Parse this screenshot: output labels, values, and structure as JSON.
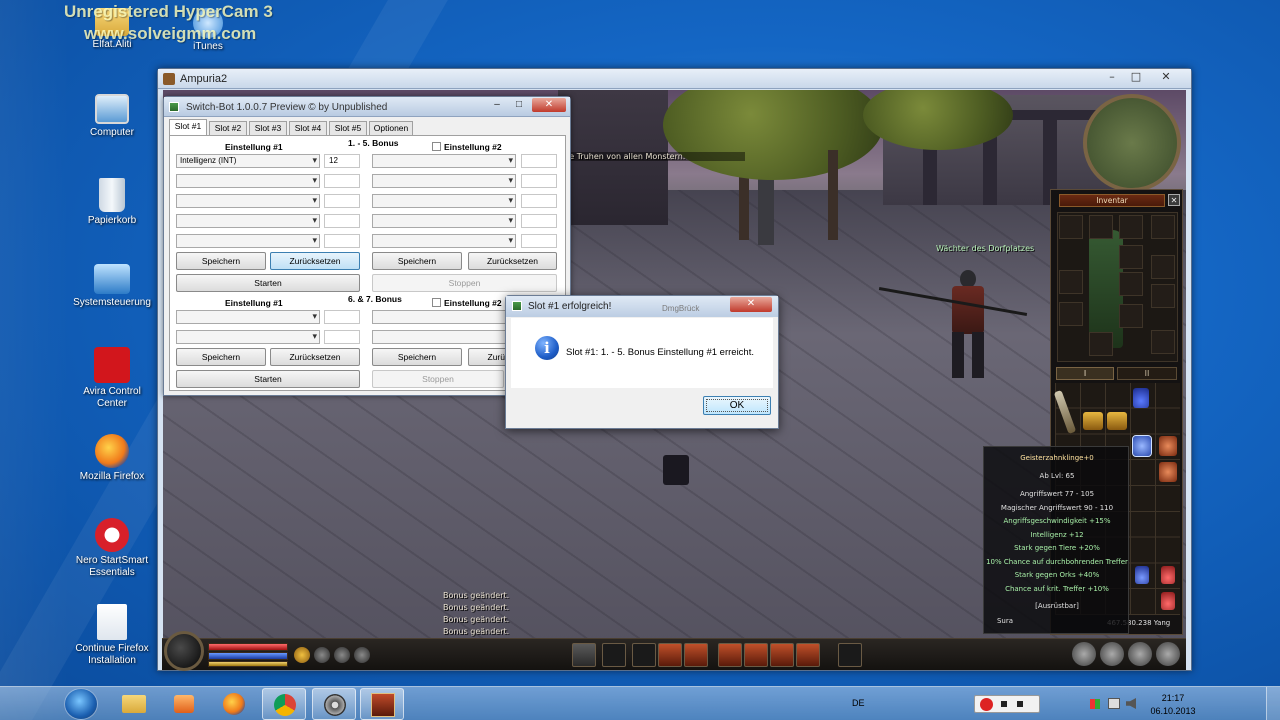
{
  "watermark": {
    "line1": "Unregistered HyperCam 3",
    "line2": "www.solveigmm.com"
  },
  "desktop_icons": [
    {
      "label": "Elfat.Aliti",
      "icon": "folder-icon"
    },
    {
      "label": "iTunes",
      "icon": "itunes-icon"
    },
    {
      "label": "Computer",
      "icon": "computer-icon"
    },
    {
      "label": "Papierkorb",
      "icon": "recycle-bin-icon"
    },
    {
      "label": "Systemsteuerung",
      "icon": "control-panel-icon"
    },
    {
      "label": "Avira Control Center",
      "icon": "avira-icon"
    },
    {
      "label": "Mozilla Firefox",
      "icon": "firefox-icon"
    },
    {
      "label": "Nero StartSmart Essentials",
      "icon": "nero-icon"
    },
    {
      "label": "Continue Firefox Installation",
      "icon": "installer-icon"
    }
  ],
  "game_window": {
    "title": "Ampuria2",
    "buttons": {
      "minimize": "–",
      "maximize": "□",
      "close": "✕"
    }
  },
  "game_hud": {
    "chat_top": "le Truhen von allen Monstern.",
    "npc_name": "Wächter des Dorfplatzes",
    "chat_lines": [
      "Bonus geändert.",
      "Bonus geändert.",
      "Bonus geändert.",
      "Bonus geändert."
    ]
  },
  "switchbot": {
    "title": "Switch-Bot 1.0.0.7 Preview © by Unpublished",
    "buttons": {
      "minimize": "–",
      "maximize": "□",
      "close": "✕"
    },
    "tabs": [
      "Slot #1",
      "Slot #2",
      "Slot #3",
      "Slot #4",
      "Slot #5",
      "Optionen"
    ],
    "section1_title": "1. - 5. Bonus",
    "section2_title": "6. & 7. Bonus",
    "einstellung1": "Einstellung #1",
    "einstellung2": "Einstellung #2",
    "bonus_row1_select": "Intelligenz (INT)",
    "bonus_row1_value": "12",
    "speichern": "Speichern",
    "zuruecksetzen": "Zurücksetzen",
    "starten": "Starten",
    "stoppen": "Stoppen",
    "zuruecksetzen_short": "Zurü"
  },
  "message_box": {
    "title": "Slot #1 erfolgreich!",
    "message": "Slot #1: 1. - 5. Bonus Einstellung #1 erreicht.",
    "ok": "OK",
    "close": "✕",
    "behind_label": "DmgBrück"
  },
  "inventory": {
    "title": "Inventar",
    "close": "✕",
    "page_tabs": [
      "I",
      "II"
    ],
    "yang": "467.580.238 Yang"
  },
  "tooltip": {
    "lines": [
      "Geisterzahnklinge+0",
      "Ab Lvl: 65",
      "Angriffswert 77 - 105",
      "Magischer Angriffswert 90 - 110",
      "Angriffsgeschwindigkeit +15%",
      "Intelligenz +12",
      "Stark gegen Tiere +20%",
      "10% Chance auf durchbohrenden Treffer",
      "Stark gegen Orks +40%",
      "Chance auf krit. Treffer +10%",
      "[Ausrüstbar]",
      "Sura"
    ]
  },
  "taskbar": {
    "language": "DE",
    "time": "21:17",
    "date": "06.10.2013",
    "pinned": [
      "start-orb-icon",
      "explorer-icon",
      "media-player-icon",
      "firefox-icon",
      "chrome-icon",
      "film-reel-icon",
      "game-icon"
    ]
  }
}
